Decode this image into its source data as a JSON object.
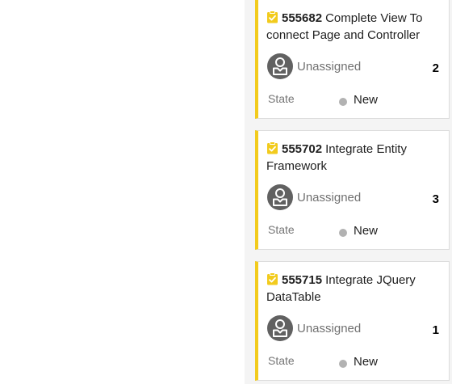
{
  "board": {
    "cards": [
      {
        "id": "555682",
        "title": "Complete View To connect Page and Controller",
        "assignee": "Unassigned",
        "rank": "2",
        "field_label": "State",
        "state": "New"
      },
      {
        "id": "555702",
        "title": "Integrate Entity Framework",
        "assignee": "Unassigned",
        "rank": "3",
        "field_label": "State",
        "state": "New"
      },
      {
        "id": "555715",
        "title": "Integrate JQuery DataTable",
        "assignee": "Unassigned",
        "rank": "1",
        "field_label": "State",
        "state": "New"
      }
    ]
  },
  "colors": {
    "card_accent": "#f2cb1d",
    "state_new_dot": "#b2b2b2",
    "avatar_bg": "#616161"
  },
  "icons": {
    "work_item": "clipboard-check-icon",
    "avatar": "unassigned-user-icon"
  }
}
